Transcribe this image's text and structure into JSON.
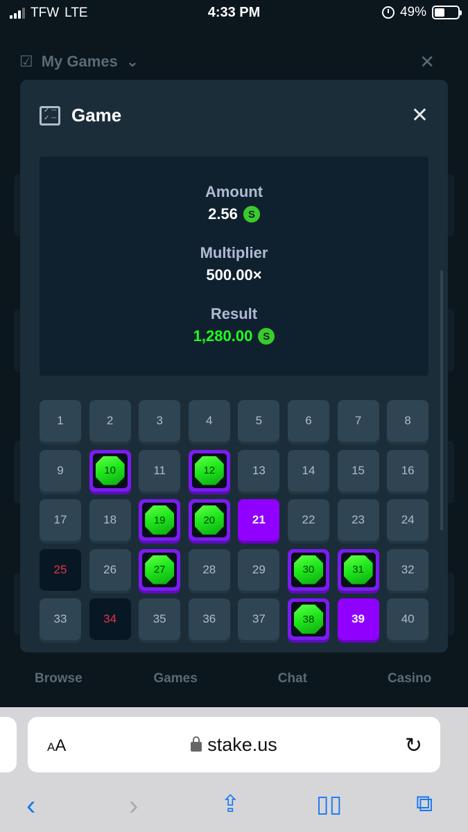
{
  "status_bar": {
    "carrier": "TFW",
    "network": "LTE",
    "time": "4:33 PM",
    "battery": "49%"
  },
  "background": {
    "title": "My Games",
    "nav": [
      "Browse",
      "Games",
      "Chat",
      "Casino"
    ]
  },
  "modal": {
    "title": "Game",
    "amount_label": "Amount",
    "amount_value": "2.56",
    "multiplier_label": "Multiplier",
    "multiplier_value": "500.00×",
    "result_label": "Result",
    "result_value": "1,280.00",
    "currency_symbol": "S",
    "tiles": [
      {
        "n": "1",
        "s": "idle"
      },
      {
        "n": "2",
        "s": "idle"
      },
      {
        "n": "3",
        "s": "idle"
      },
      {
        "n": "4",
        "s": "idle"
      },
      {
        "n": "5",
        "s": "idle"
      },
      {
        "n": "6",
        "s": "idle"
      },
      {
        "n": "7",
        "s": "idle"
      },
      {
        "n": "8",
        "s": "idle"
      },
      {
        "n": "9",
        "s": "idle"
      },
      {
        "n": "10",
        "s": "hit"
      },
      {
        "n": "11",
        "s": "idle"
      },
      {
        "n": "12",
        "s": "hit"
      },
      {
        "n": "13",
        "s": "idle"
      },
      {
        "n": "14",
        "s": "idle"
      },
      {
        "n": "15",
        "s": "idle"
      },
      {
        "n": "16",
        "s": "idle"
      },
      {
        "n": "17",
        "s": "idle"
      },
      {
        "n": "18",
        "s": "idle"
      },
      {
        "n": "19",
        "s": "hit"
      },
      {
        "n": "20",
        "s": "hit"
      },
      {
        "n": "21",
        "s": "pick"
      },
      {
        "n": "22",
        "s": "idle"
      },
      {
        "n": "23",
        "s": "idle"
      },
      {
        "n": "24",
        "s": "idle"
      },
      {
        "n": "25",
        "s": "miss"
      },
      {
        "n": "26",
        "s": "idle"
      },
      {
        "n": "27",
        "s": "hit"
      },
      {
        "n": "28",
        "s": "idle"
      },
      {
        "n": "29",
        "s": "idle"
      },
      {
        "n": "30",
        "s": "hit"
      },
      {
        "n": "31",
        "s": "hit"
      },
      {
        "n": "32",
        "s": "idle"
      },
      {
        "n": "33",
        "s": "idle"
      },
      {
        "n": "34",
        "s": "miss"
      },
      {
        "n": "35",
        "s": "idle"
      },
      {
        "n": "36",
        "s": "idle"
      },
      {
        "n": "37",
        "s": "idle"
      },
      {
        "n": "38",
        "s": "hit"
      },
      {
        "n": "39",
        "s": "pick"
      },
      {
        "n": "40",
        "s": "idle"
      }
    ]
  },
  "browser": {
    "text_size_label_small": "A",
    "text_size_label_large": "A",
    "url": "stake.us"
  },
  "colors": {
    "modal_bg": "#1b2d39",
    "tile_bg": "#2f4553",
    "gem_green": "#1fe81b",
    "pick_purple": "#9000ff",
    "result_green": "#1fff20"
  }
}
